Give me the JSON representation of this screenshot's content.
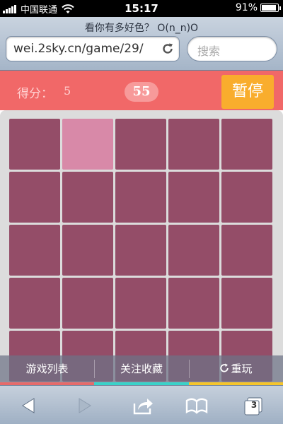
{
  "status_bar": {
    "carrier": "中国联通",
    "time": "15:17",
    "battery_percent": "91%",
    "battery_level": 0.91
  },
  "browser": {
    "page_title": "看你有多好色？ O(n_n)O",
    "url": "wei.2sky.cn/game/29/",
    "search_placeholder": "搜索"
  },
  "game": {
    "score_label": "得分：",
    "score": "5",
    "time_left": "55",
    "pause_label": "暂停",
    "grid_size": 5,
    "visible_rows": 5,
    "tile_color": "#944d68",
    "odd_tile_color": "#d889a8",
    "odd_tile": {
      "row": 0,
      "col": 1
    }
  },
  "bottom_menu": {
    "games_label": "游戏列表",
    "follow_label": "关注收藏",
    "replay_label": "重玩"
  },
  "color_strip": [
    "#e66a6a",
    "#39d2c9",
    "#f5c52b"
  ],
  "toolbar": {
    "tabs_count": "3"
  }
}
